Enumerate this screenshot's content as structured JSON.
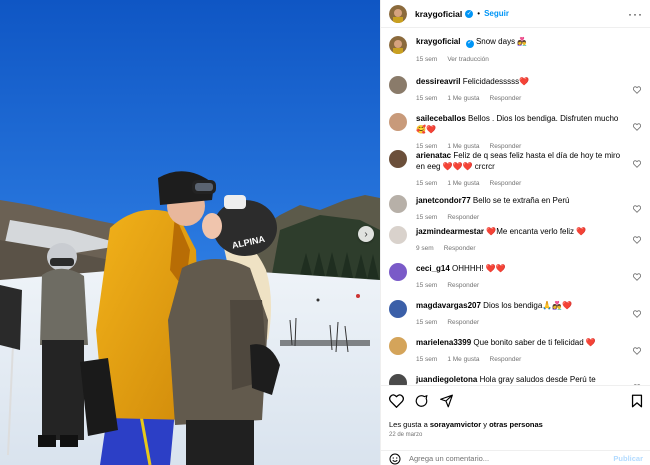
{
  "post": {
    "username": "kraygoficial",
    "follow_label": "Seguir",
    "caption_text": "Snow days 👩‍❤️‍👨",
    "caption_time": "15 sem",
    "translate_label": "Ver traducción"
  },
  "comments": [
    {
      "user": "dessireavril",
      "text": "Felicidadesssss❤️",
      "time": "15 sem",
      "likes": "1 Me gusta",
      "reply": "Responder",
      "avatar_color": "#8a7b6a"
    },
    {
      "user": "saileceballos",
      "text": "Bellos . Dios los bendiga. Disfruten mucho 🥰❤️",
      "time": "15 sem",
      "likes": "1 Me gusta",
      "reply": "Responder",
      "avatar_color": "#c89a7a"
    },
    {
      "user": "arienatac",
      "text": "Feliz de q seas feliz hasta el día de hoy te miro en eeg ❤️❤️❤️ crcrcr",
      "time": "15 sem",
      "likes": "1 Me gusta",
      "reply": "Responder",
      "avatar_color": "#6b4f3a"
    },
    {
      "user": "janetcondor77",
      "text": "Bello se te extraña en Perú",
      "time": "15 sem",
      "likes": "",
      "reply": "Responder",
      "avatar_color": "#b7b0a8"
    },
    {
      "user": "jazmindearmestar",
      "text": "❤️Me encanta verlo feliz ❤️",
      "time": "9 sem",
      "likes": "",
      "reply": "Responder",
      "avatar_color": "#d9d2cc"
    },
    {
      "user": "ceci_g14",
      "text": "OHHHH! ❤️❤️",
      "time": "15 sem",
      "likes": "",
      "reply": "Responder",
      "avatar_color": "#7a5ac8"
    },
    {
      "user": "magdavargas207",
      "text": "Dios los bendiga🙏👩‍❤️‍👨❤️",
      "time": "15 sem",
      "likes": "",
      "reply": "Responder",
      "avatar_color": "#3b5fa8"
    },
    {
      "user": "marielena3399",
      "text": "Que bonito saber de ti felicidad ❤️",
      "time": "15 sem",
      "likes": "1 Me gusta",
      "reply": "Responder",
      "avatar_color": "#d4a45a"
    },
    {
      "user": "juandiegoletona",
      "text": "Hola gray saludos desde Perú te extrañamos",
      "time": "",
      "likes": "",
      "reply": "",
      "avatar_color": "#4a4a4a"
    }
  ],
  "footer": {
    "likes_prefix": "Les gusta a ",
    "likes_user": "sorayamvictor",
    "likes_joiner": " y ",
    "likes_others": "otras personas",
    "date": "22 de marzo",
    "comment_placeholder": "Agrega un comentario...",
    "publish_label": "Publicar"
  },
  "colors": {
    "accent": "#0095f6",
    "muted": "#737373",
    "heart": "#e0213a",
    "sky": "#1a63c9"
  },
  "icons": [
    "verified-icon",
    "more-icon",
    "heart-icon",
    "comment-icon",
    "share-icon",
    "bookmark-icon",
    "emoji-icon",
    "chevron-right-icon"
  ]
}
